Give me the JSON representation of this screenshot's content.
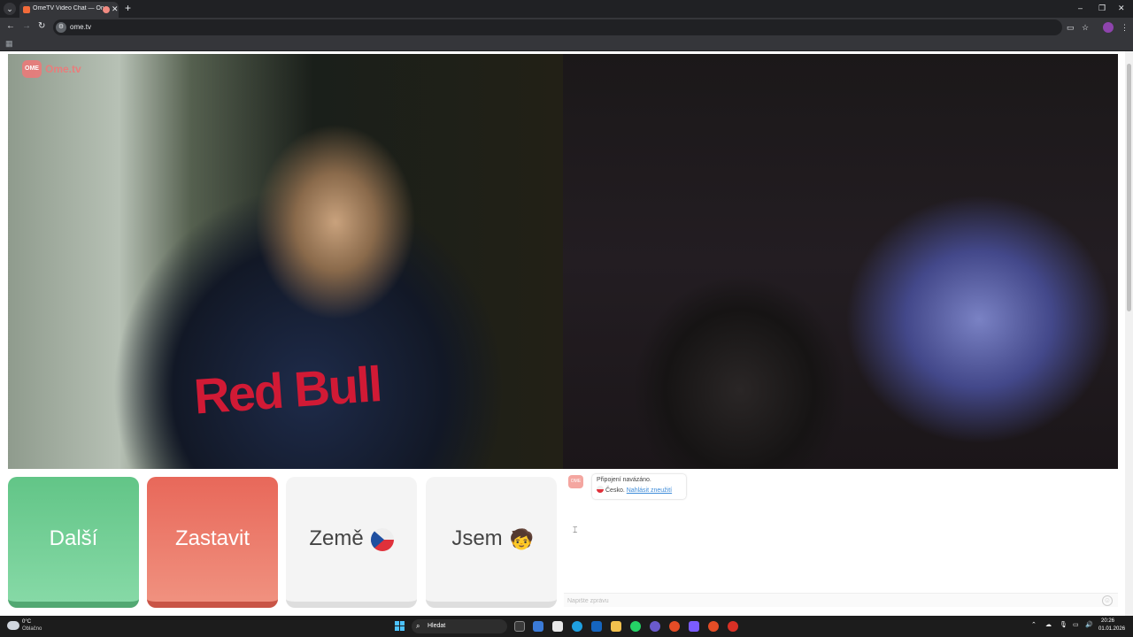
{
  "browser": {
    "tab_title": "OmeTV Video Chat — Ome",
    "tab_close": "✕",
    "new_tab": "+",
    "url": "ome.tv",
    "window_controls": {
      "minimize": "–",
      "restore": "❐",
      "close": "✕"
    }
  },
  "page": {
    "logo_text": "Ome.tv",
    "logo_badge": "OME",
    "buttons": {
      "next": "Další",
      "stop": "Zastavit",
      "country": "Země",
      "gender": "Jsem"
    },
    "gender_emoji": "🧒",
    "chat": {
      "avatar_label": "OME",
      "message_line1": "Připojení navázáno.",
      "country": "Česko.",
      "report_link": "Nahlásit zneužití",
      "input_placeholder": "Napište zprávu"
    },
    "figure_text": "Red Bull"
  },
  "taskbar": {
    "weather_temp": "0°C",
    "weather_desc": "Oblačno",
    "search_label": "Hledat",
    "time": "20:26",
    "date": "01.01.2026"
  },
  "colors": {
    "next_green": "#62c587",
    "stop_red": "#e8685a",
    "link_blue": "#3c8bd9",
    "brand_pink": "#f07878"
  }
}
